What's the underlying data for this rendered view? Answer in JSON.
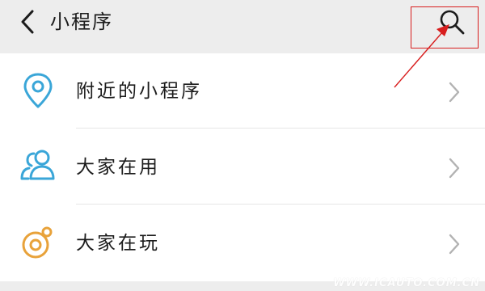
{
  "header": {
    "title": "小程序",
    "back_icon": "chevron-left-icon",
    "search_icon": "search-icon"
  },
  "list": {
    "items": [
      {
        "label": "附近的小程序",
        "icon": "location-pin-icon",
        "icon_color": "#3aa6d8"
      },
      {
        "label": "大家在用",
        "icon": "people-icon",
        "icon_color": "#3aa6d8"
      },
      {
        "label": "大家在玩",
        "icon": "game-icon",
        "icon_color": "#e8a23a"
      }
    ],
    "chevron_icon": "chevron-right-icon"
  },
  "annotation": {
    "color": "#d81e1e"
  },
  "watermark": {
    "text": "WWW.ICAUTO.COM.CN"
  }
}
